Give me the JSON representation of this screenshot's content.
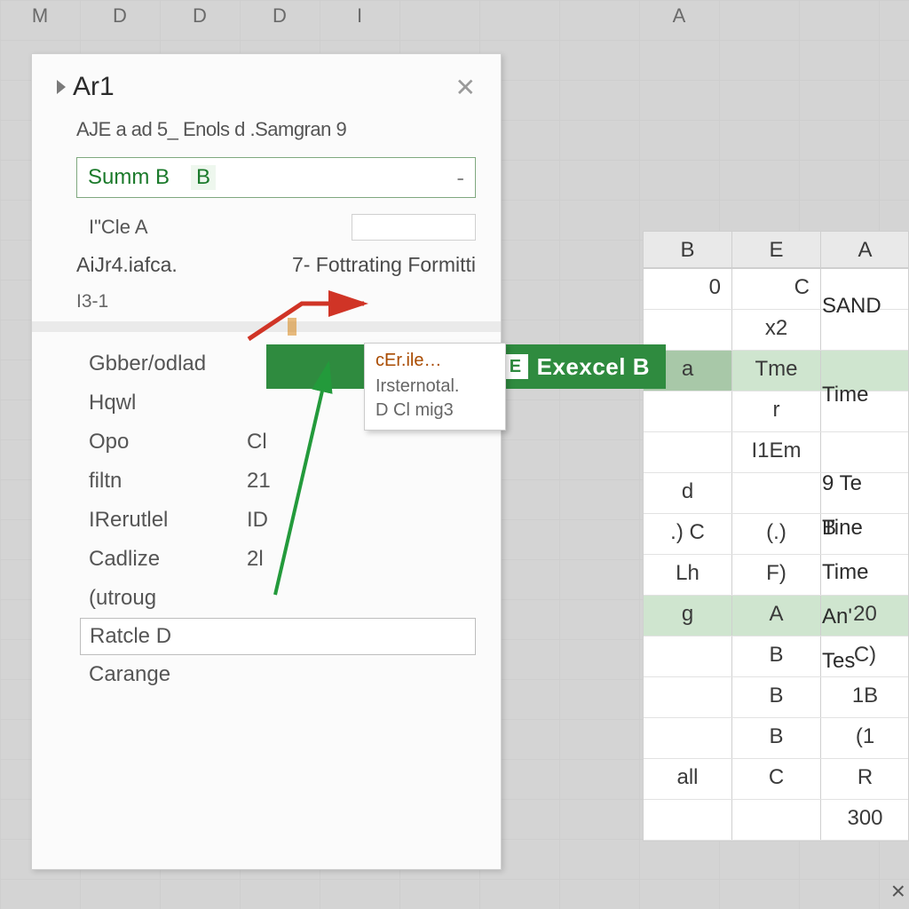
{
  "bg_columns": [
    "M",
    "D",
    "D",
    "D",
    "I",
    "",
    "",
    "",
    "A"
  ],
  "panel": {
    "title": "Ar1",
    "subtitle": "AJE a ad 5_  Enols  d .Samgran 9",
    "dropdown": {
      "main": "Summ B",
      "col": "B",
      "arrow": "-"
    },
    "mini_row": {
      "label": "I\"Cle A"
    },
    "section_row": {
      "left": "AiJr4.iafca.",
      "right": "7- Fottrating Formitti"
    },
    "section_small": "I3-1",
    "list": [
      {
        "k": "Gbber/odlad",
        "v": ""
      },
      {
        "k": "Hqwl",
        "v": ""
      },
      {
        "k": "Opo",
        "v": "Cl"
      },
      {
        "k": "filtn",
        "v": "21"
      },
      {
        "k": "IRerutlel",
        "v": "ID"
      },
      {
        "k": "Cadlize",
        "v": "2l"
      },
      {
        "k": "(utroug",
        "v": ""
      },
      {
        "k": "Ratcle D",
        "v": "",
        "selected": true
      },
      {
        "k": "Carange",
        "v": ""
      }
    ]
  },
  "tooltip": {
    "title": "cEr.ile…",
    "line1": "Irsternotal.",
    "line2": "D Cl mig3"
  },
  "excel_bar": {
    "logo": "E",
    "text": "Exexcel B"
  },
  "sheet": {
    "headers": [
      "B",
      "E",
      "A"
    ],
    "close": "×",
    "rows_top": [
      [
        "0",
        "C",
        "SAND"
      ],
      [
        "",
        "x2",
        ""
      ]
    ],
    "time_row": [
      "a",
      "Tme",
      ""
    ],
    "rows_mid": [
      [
        "",
        "r",
        "9 Te Tine"
      ],
      [
        "",
        "I1Em",
        "B"
      ],
      [
        "d",
        "",
        "Time"
      ],
      [
        ".)  C",
        "(.)",
        "An'"
      ],
      [
        "Lh",
        "F)",
        "Tes"
      ]
    ],
    "rows_low": [
      [
        "g",
        "A",
        "20"
      ],
      [
        "",
        "B",
        "C)"
      ],
      [
        "",
        "B",
        "1B"
      ],
      [
        "",
        "B",
        "(1"
      ],
      [
        "all",
        "C",
        "R"
      ],
      [
        "",
        "",
        "300"
      ]
    ]
  },
  "side_labels": [
    "SAND",
    "",
    "Time",
    "",
    "9 Te Tine",
    "B",
    "Time",
    "An'",
    "Tes"
  ],
  "scroll_corner": "×"
}
